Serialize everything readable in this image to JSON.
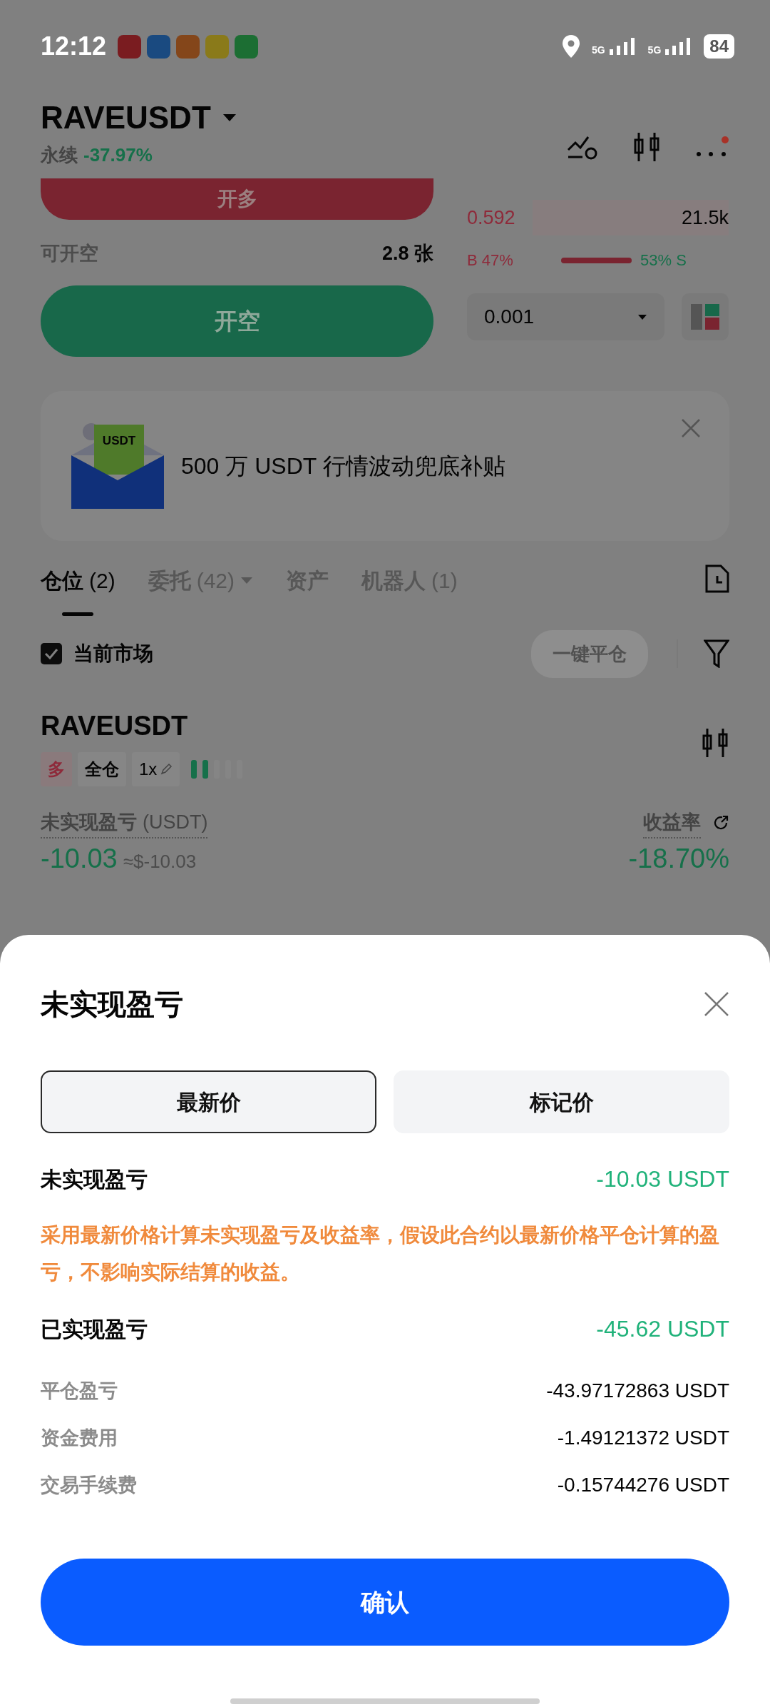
{
  "status_bar": {
    "time": "12:12",
    "apps": [
      {
        "color": "#7a1c20"
      },
      {
        "color": "#1a4a80"
      },
      {
        "color": "#84461a"
      },
      {
        "color": "#8a7a1a"
      },
      {
        "color": "#1c6e33"
      }
    ],
    "network": [
      "5G",
      "5G"
    ],
    "battery": "84"
  },
  "header": {
    "symbol": "RAVEUSDT",
    "type": "永续",
    "change": "-37.97%"
  },
  "trade": {
    "long_button": "开多",
    "available_label": "可开空",
    "available_value": "2.8 张",
    "short_button": "开空"
  },
  "order_book": {
    "asks": [
      {
        "price": "0.592",
        "size": "21.5k"
      }
    ],
    "buy_ratio": "B 47%",
    "sell_ratio": "53% S",
    "precision": "0.001"
  },
  "banner": {
    "icon_label": "USDT",
    "text": "500 万 USDT 行情波动兜底补贴"
  },
  "tabs": [
    {
      "label": "仓位",
      "count": "(2)",
      "selected": true,
      "dropdown": false
    },
    {
      "label": "委托",
      "count": "(42)",
      "selected": false,
      "dropdown": true
    },
    {
      "label": "资产",
      "selected": false,
      "dropdown": false
    },
    {
      "label": "机器人",
      "count": "(1)",
      "selected": false,
      "dropdown": false
    }
  ],
  "filter": {
    "label": "当前市场",
    "checked": true,
    "close_all": "一键平仓"
  },
  "position": {
    "symbol": "RAVEUSDT",
    "side": "多",
    "margin_mode": "全仓",
    "leverage": "1x",
    "risk": {
      "level": 0.4
    },
    "pnl_label": "未实现盈亏",
    "pnl_unit": "(USDT)",
    "pnl": "-10.03",
    "pnl_usd": "≈$-10.03",
    "roe_label": "收益率",
    "roe": "-18.70%"
  },
  "sheet": {
    "title": "未实现盈亏",
    "tabs": [
      {
        "label": "最新价",
        "selected": true
      },
      {
        "label": "标记价",
        "selected": false
      }
    ],
    "unrealized": {
      "label": "未实现盈亏",
      "value": "-10.03 USDT"
    },
    "note": "采用最新价格计算未实现盈亏及收益率，假设此合约以最新价格平仓计算的盈亏，不影响实际结算的收益。",
    "realized": {
      "label": "已实现盈亏",
      "value": "-45.62 USDT"
    },
    "breakdown": [
      {
        "label": "平仓盈亏",
        "value": "-43.97172863 USDT"
      },
      {
        "label": "资金费用",
        "value": "-1.49121372 USDT"
      },
      {
        "label": "交易手续费",
        "value": "-0.15744276 USDT"
      }
    ],
    "confirm": "确认"
  }
}
